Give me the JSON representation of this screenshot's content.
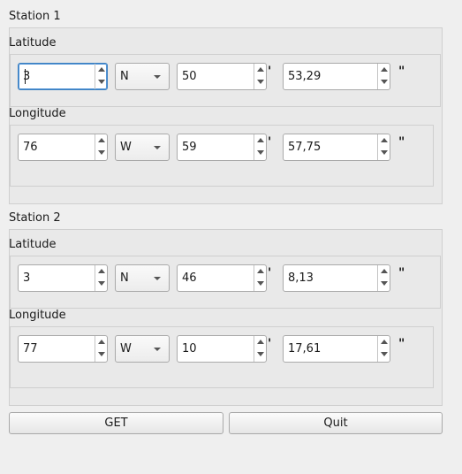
{
  "station1": {
    "title": "Station 1",
    "latitude": {
      "label": "Latitude",
      "degrees": "3",
      "hemisphere": "N",
      "minutes": "50",
      "seconds": "53,29"
    },
    "longitude": {
      "label": "Longitude",
      "degrees": "76",
      "hemisphere": "W",
      "minutes": "59",
      "seconds": "57,75"
    }
  },
  "station2": {
    "title": "Station 2",
    "latitude": {
      "label": "Latitude",
      "degrees": "3",
      "hemisphere": "N",
      "minutes": "46",
      "seconds": "8,13"
    },
    "longitude": {
      "label": "Longitude",
      "degrees": "77",
      "hemisphere": "W",
      "minutes": "10",
      "seconds": "17,61"
    }
  },
  "symbols": {
    "minute": "'",
    "second": "\""
  },
  "buttons": {
    "get": "GET",
    "quit": "Quit"
  },
  "colors": {
    "focus_border": "#3d80c0",
    "background": "#efefef"
  }
}
